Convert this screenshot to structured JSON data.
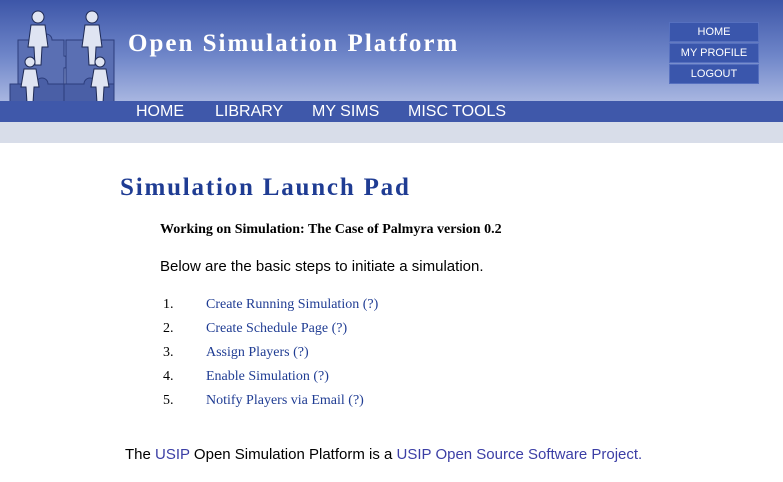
{
  "header": {
    "site_title": "Open Simulation Platform",
    "top_links": [
      "HOME",
      "MY PROFILE",
      "LOGOUT"
    ]
  },
  "nav": {
    "items": [
      "HOME",
      "LIBRARY",
      "MY SIMS",
      "MISC TOOLS"
    ]
  },
  "main": {
    "page_title": "Simulation Launch Pad",
    "working_on": "Working on Simulation: The Case of Palmyra version 0.2",
    "intro": "Below are the basic steps to initiate a simulation.",
    "steps": [
      {
        "num": "1.",
        "label": "Create Running Simulation (?)"
      },
      {
        "num": "2.",
        "label": "Create Schedule Page (?)"
      },
      {
        "num": "3.",
        "label": "Assign Players (?)"
      },
      {
        "num": "4.",
        "label": "Enable Simulation (?)"
      },
      {
        "num": "5.",
        "label": "Notify Players via Email (?)"
      }
    ]
  },
  "footer": {
    "prefix": "The ",
    "link1": "USIP",
    "middle": " Open Simulation Platform is a ",
    "link2": "USIP Open Source Software Project."
  },
  "colors": {
    "header_top": "#3d56a8",
    "nav_bar": "#3f58aa",
    "title_blue": "#1f3c93",
    "sub_bar": "#d8dde9"
  },
  "icons": {
    "logo": "puzzle-figures-logo-icon"
  }
}
